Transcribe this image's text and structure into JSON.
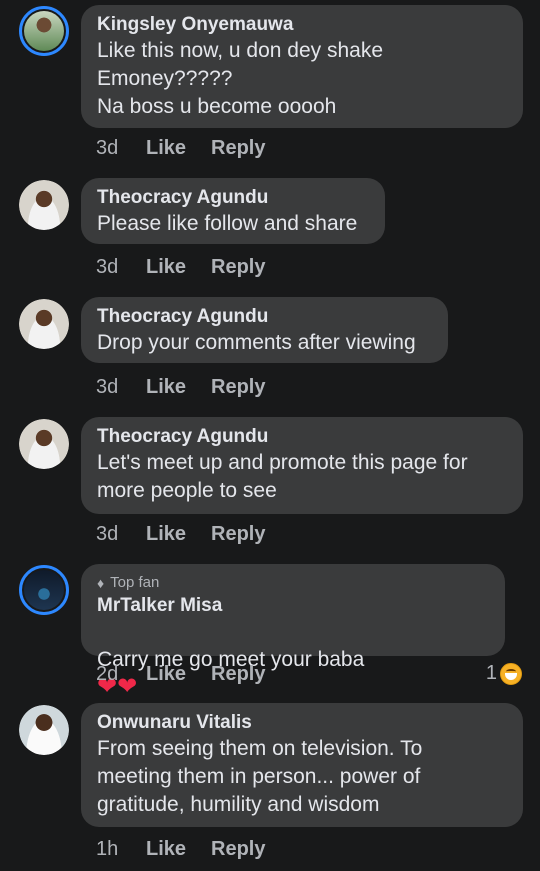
{
  "comments": [
    {
      "name": "Kingsley Onyemauwa",
      "text": "Like this now, u don dey shake\nEmoney?????\nNa boss u become ooooh",
      "time": "3d",
      "like": "Like",
      "reply": "Reply"
    },
    {
      "name": "Theocracy Agundu",
      "text": "Please like follow and share",
      "time": "3d",
      "like": "Like",
      "reply": "Reply"
    },
    {
      "name": "Theocracy Agundu",
      "text": "Drop your comments after viewing",
      "time": "3d",
      "like": "Like",
      "reply": "Reply"
    },
    {
      "name": "Theocracy Agundu",
      "text": "Let's meet up and promote this page for\nmore people to see",
      "time": "3d",
      "like": "Like",
      "reply": "Reply"
    },
    {
      "badge": "Top fan",
      "name": "MrTalker Misa",
      "text": "Carry me go meet your baba",
      "time": "2d",
      "like": "Like",
      "reply": "Reply",
      "reaction_count": "1"
    },
    {
      "name": "Onwunaru Vitalis",
      "text": "From seeing them on television. To\nmeeting them in person... power of\ngratitude, humility and wisdom",
      "time": "1h",
      "like": "Like",
      "reply": "Reply"
    }
  ],
  "colors": {
    "background": "#18191a",
    "bubble": "#3a3b3c",
    "ring": "#2d88ff"
  }
}
